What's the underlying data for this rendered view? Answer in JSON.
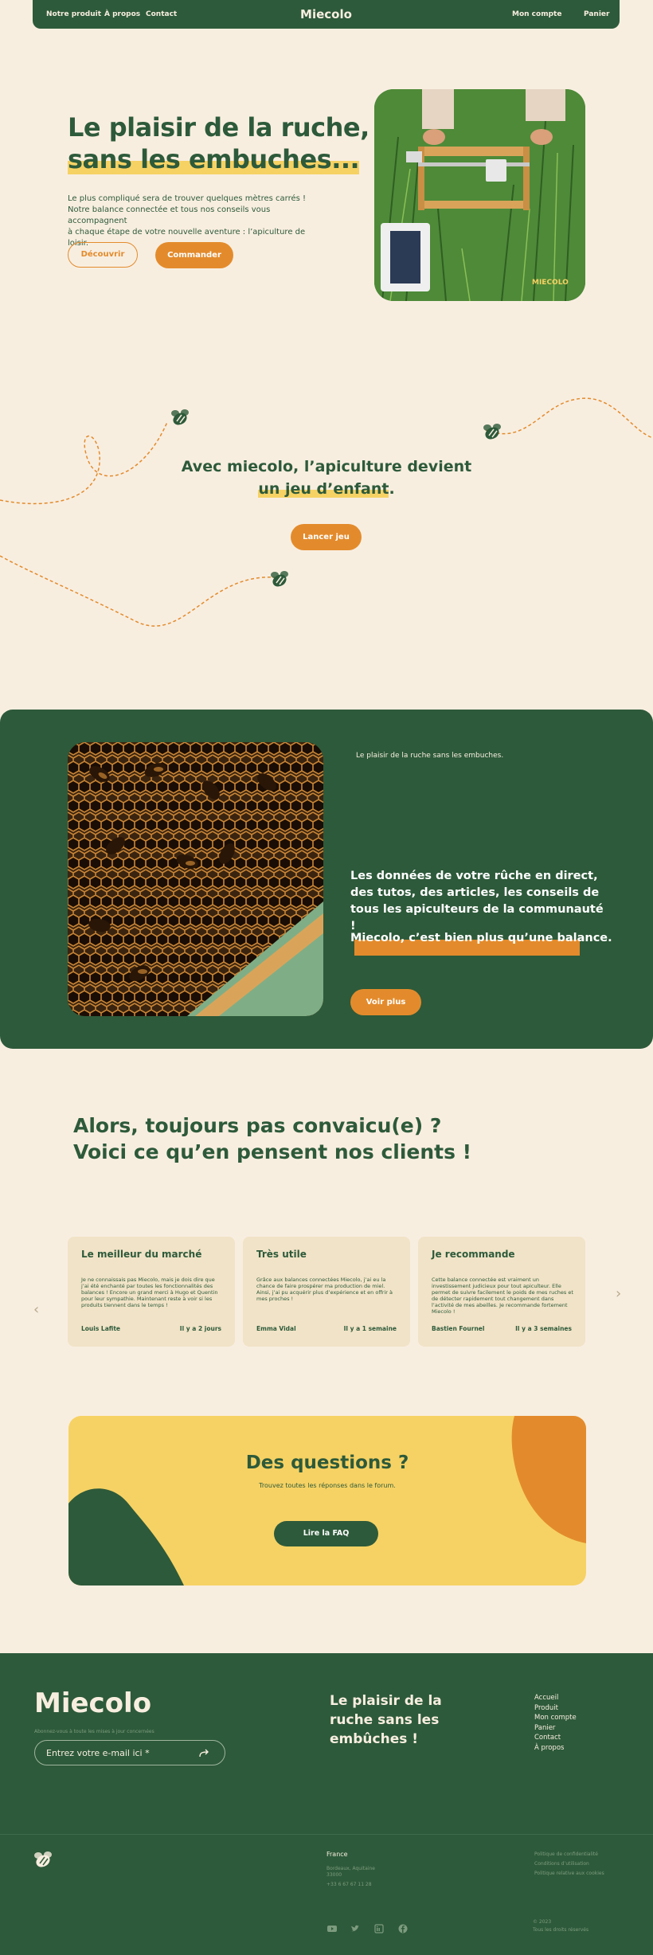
{
  "nav": {
    "left_links": [
      "Notre produit",
      "À propos",
      "Contact"
    ],
    "logo": "Miecolo",
    "account": "Mon compte",
    "cart": "Panier"
  },
  "hero": {
    "title_line1": "Le plaisir de la ruche,",
    "title_line2": "sans les embuches...",
    "text_line1": "Le plus compliqué sera de trouver quelques mètres carrés !",
    "text_line2": "Notre balance connectée et tous nos conseils vous accompagnent",
    "text_line3": "à chaque étape de votre nouvelle aventure : l’apiculture de loisir.",
    "discover": "Découvrir",
    "order": "Commander",
    "image_watermark": "MIECOLO"
  },
  "game": {
    "title_line1": "Avec miecolo, l’apiculture devient",
    "title_highlight": "un jeu d’enfant",
    "title_end": ".",
    "button": "Lancer jeu"
  },
  "green_section": {
    "small_text": "Le plaisir de la ruche sans les embuches.",
    "text": "Les données de votre rûche en direct, des tutos, des articles, les conseils de tous les apiculteurs de la communauté !",
    "highlight": "Miecolo, c’est bien plus qu’une balance.",
    "button": "Voir plus"
  },
  "testimonials": {
    "title_line1": "Alors, toujours pas convaicu(e) ?",
    "title_line2": "Voici ce qu’en pensent nos clients !",
    "cards": [
      {
        "title": "Le meilleur du marché",
        "text": "Je ne connaissais pas Miecolo, mais je dois dire que j’ai été enchanté par toutes les fonctionnalités des balances ! Encore un grand merci à Hugo et Quentin pour leur sympathie. Maintenant reste à voir si les produits tiennent dans le temps !",
        "author": "Louis Lafite",
        "time": "Il y a 2 jours"
      },
      {
        "title": "Très utile",
        "text": "Grâce aux balances connectées Miecolo, j’ai eu la chance de faire prospérer ma production de miel. Ainsi, j’ai pu acquérir plus d’expérience et en offrir à mes proches !",
        "author": "Emma Vidal",
        "time": "Il y a 1 semaine"
      },
      {
        "title": "Je recommande",
        "text": "Cette balance connectée est vraiment un investissement judicieux pour tout apiculteur. Elle permet de suivre facilement le poids de mes ruches et de détecter rapidement tout changement dans l’activité de mes abeilles. Je recommande fortement Miecolo !",
        "author": "Bastien Fournel",
        "time": "Il y a 3 semaines"
      }
    ],
    "prev": "‹",
    "next": "›"
  },
  "faq": {
    "title": "Des questions ?",
    "subtitle": "Trouvez toutes les réponses dans le forum.",
    "button": "Lire la FAQ"
  },
  "footer": {
    "logo": "Miecolo",
    "newsletter_note": "Abonnez-vous à toute les mises à jour concernées",
    "input_placeholder": "Entrez votre e-mail ici  *",
    "tagline": "Le plaisir de la ruche sans les embûches !",
    "links": [
      "Accueil",
      "Produit",
      "Mon compte",
      "Panier",
      "Contact",
      "À propos"
    ],
    "country": "France",
    "address_line1": "Bordeaux, Aquitaine",
    "address_line2": "33000",
    "phone": "+33 6 67 67 11 28",
    "legal": [
      "Politique de confidentialité",
      "Conditions d’utilisation",
      "Politique relative aux cookies"
    ],
    "copyright_year": "© 2023",
    "copyright": "Tous les droits réservés"
  },
  "icons": {
    "bee": "bee-icon",
    "send": "arrow-send-icon",
    "social": [
      "youtube-icon",
      "twitter-icon",
      "linkedin-icon",
      "facebook-icon"
    ]
  },
  "colors": {
    "green": "#2d5a3a",
    "cream": "#f8eee0",
    "orange": "#e38b2c",
    "yellow": "#f6d264"
  }
}
